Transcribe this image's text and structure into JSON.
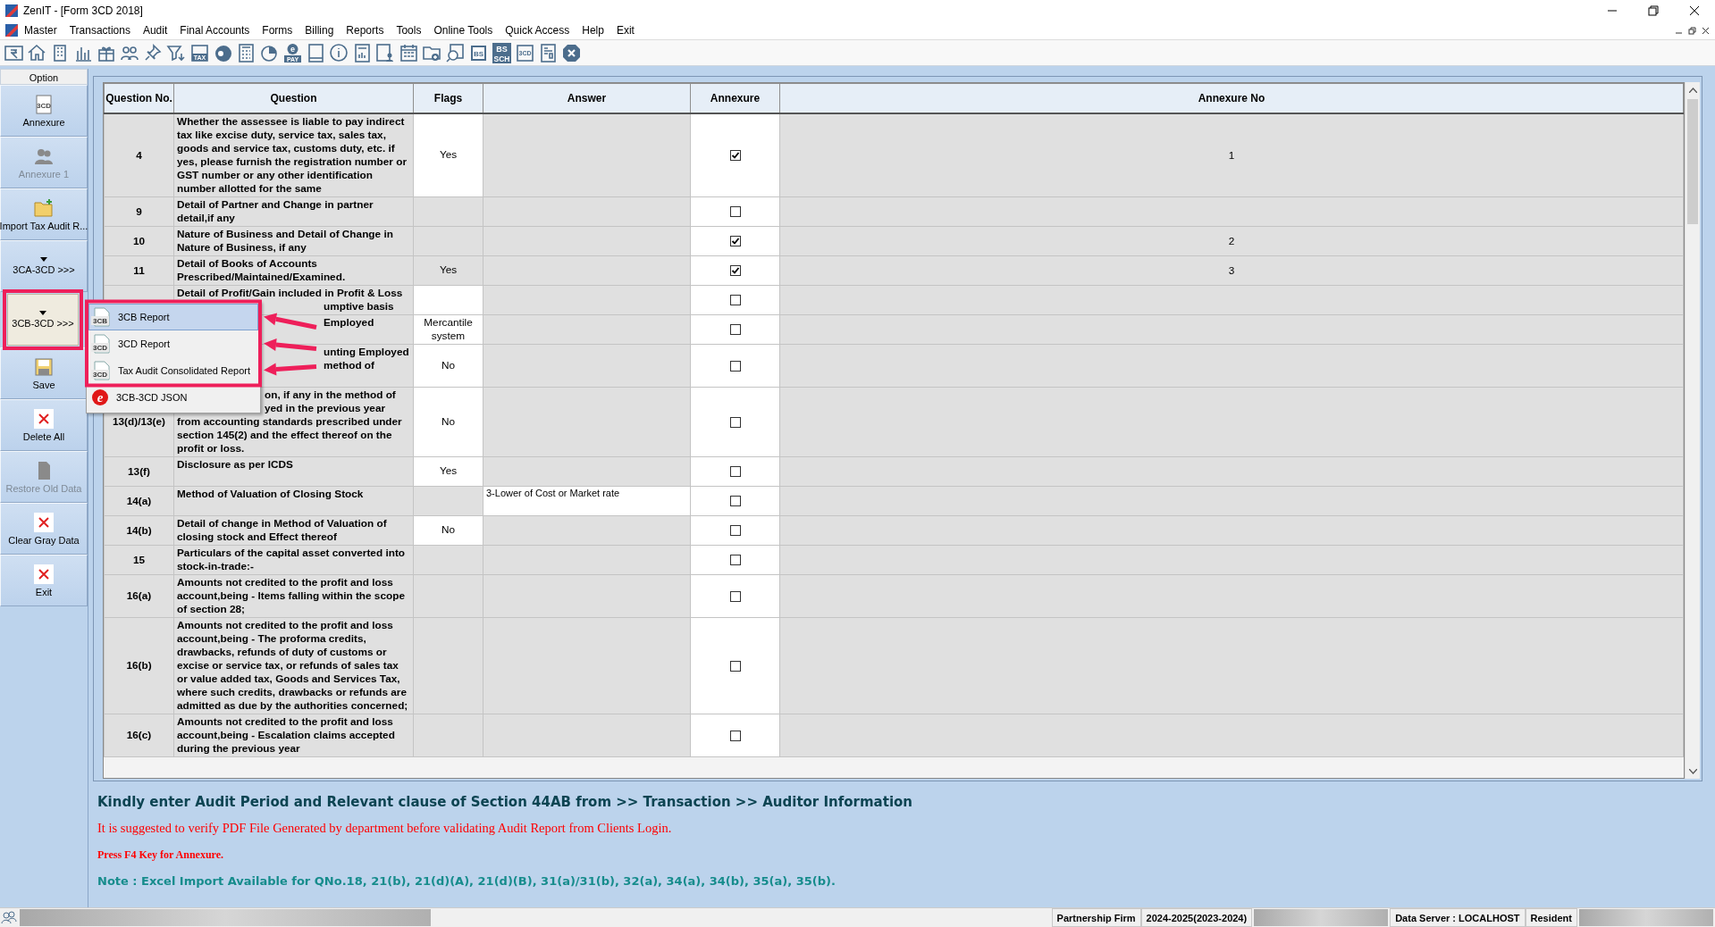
{
  "window": {
    "title": "ZenIT - [Form 3CD 2018]"
  },
  "menu": [
    "Master",
    "Transactions",
    "Audit",
    "Final Accounts",
    "Forms",
    "Billing",
    "Reports",
    "Tools",
    "Online Tools",
    "Quick Access",
    "Help",
    "Exit"
  ],
  "toolbar": [
    {
      "kind": "rupee"
    },
    {
      "kind": "home"
    },
    {
      "kind": "building"
    },
    {
      "kind": "bars"
    },
    {
      "kind": "gift"
    },
    {
      "kind": "people"
    },
    {
      "kind": "pin"
    },
    {
      "kind": "filter"
    },
    {
      "kind": "tax",
      "labels": [
        "TAX"
      ]
    },
    {
      "kind": "disc"
    },
    {
      "kind": "calc"
    },
    {
      "kind": "pie"
    },
    {
      "kind": "epay",
      "labels": [
        "e",
        "PAY"
      ]
    },
    {
      "kind": "book"
    },
    {
      "kind": "info"
    },
    {
      "kind": "report"
    },
    {
      "kind": "userdoc"
    },
    {
      "kind": "calendar"
    },
    {
      "kind": "folderplus"
    },
    {
      "kind": "searchdoc"
    },
    {
      "kind": "bs",
      "labels": [
        "BS"
      ]
    },
    {
      "kind": "bssch",
      "labels": [
        "BS",
        "SCH"
      ]
    },
    {
      "kind": "doc3cd",
      "labels": [
        "3CD"
      ]
    },
    {
      "kind": "sheet"
    },
    {
      "kind": "close"
    }
  ],
  "sidebar": {
    "title": "Option",
    "items": [
      {
        "label": "Annexure",
        "kind": "doc3cd",
        "icon_text": "3CD",
        "disabled": false,
        "pressed": false
      },
      {
        "label": "Annexure 1",
        "kind": "people",
        "disabled": true,
        "pressed": false
      },
      {
        "label": "Import Tax Audit R...",
        "kind": "folderplus",
        "disabled": false,
        "pressed": false
      },
      {
        "label": "3CA-3CD >>>",
        "kind": "dropdown",
        "disabled": false,
        "pressed": false
      },
      {
        "label": "3CB-3CD >>>",
        "kind": "dropdown",
        "disabled": false,
        "pressed": true
      },
      {
        "label": "Save",
        "kind": "save",
        "disabled": false,
        "pressed": false
      },
      {
        "label": "Delete All",
        "kind": "cross",
        "disabled": false,
        "pressed": false
      },
      {
        "label": "Restore Old Data",
        "kind": "doc",
        "disabled": true,
        "pressed": false
      },
      {
        "label": "Clear Gray Data",
        "kind": "cross",
        "disabled": false,
        "pressed": false
      },
      {
        "label": "Exit",
        "kind": "cross",
        "disabled": false,
        "pressed": false
      }
    ]
  },
  "popup_menu": {
    "items": [
      {
        "label": "3CB Report",
        "kind": "doc",
        "icon_text": "3CB",
        "selected": true
      },
      {
        "label": "3CD Report",
        "kind": "doc",
        "icon_text": "3CD",
        "selected": false
      },
      {
        "label": "Tax Audit Consolidated Report",
        "kind": "doc",
        "icon_text": "3CD",
        "selected": false
      },
      {
        "label": "3CB-3CD JSON",
        "kind": "elogo",
        "icon_text": "e",
        "selected": false
      }
    ]
  },
  "table": {
    "columns": [
      "Question No.",
      "Question",
      "Flags",
      "Answer",
      "Annexure",
      "Annexure No"
    ],
    "rows": [
      {
        "qno": "4",
        "question": [
          {
            "text": "Whether the assessee is liable to pay indirect tax like excise duty, service tax, sales tax, goods and service tax, customs duty, etc. if yes, please furnish the registration number or GST number or any other identification number allotted for the same"
          }
        ],
        "flag": "Yes",
        "flag_editable": true,
        "annexure": true,
        "annexure_no": "1"
      },
      {
        "qno": "9",
        "question": [
          {
            "text": "Detail of Partner and Change in partner detail,if any"
          }
        ],
        "flag_editable": false,
        "annexure": false
      },
      {
        "qno": "10",
        "question": [
          {
            "text": "Nature of Business and Detail of Change in Nature of Business, if any"
          }
        ],
        "flag_editable": false,
        "annexure": true,
        "annexure_no": "2"
      },
      {
        "qno": "11",
        "question": [
          {
            "text": "Detail of Books of Accounts Prescribed/Maintained/Examined."
          }
        ],
        "flag": "Yes",
        "flag_editable": false,
        "annexure": true,
        "annexure_no": "3"
      },
      {
        "question": [
          {
            "text": "Detail of Profit/Gain included in Profit & Loss"
          },
          {
            "text": "umptive basis",
            "cut": true
          }
        ],
        "flag_editable": true,
        "annexure": false
      },
      {
        "question": [
          {
            "text": "Employed",
            "cut": true
          }
        ],
        "flag": "Mercantile system",
        "flag_editable": true,
        "annexure": false
      },
      {
        "question": [
          {
            "text": "unting Employed",
            "cut": true
          },
          {
            "text": "method of",
            "cut": true
          }
        ],
        "flag": "No",
        "flag_editable": true,
        "annexure": false
      },
      {
        "qno": "13(d)/13(e)",
        "question": [
          {
            "text": "on, if any in the method of",
            "cut": true
          },
          {
            "text": "yed in the previous year",
            "cut": true
          },
          {
            "text": "from accounting standards prescribed under section 145(2) and the effect thereof on the profit or loss."
          }
        ],
        "flag": "No",
        "flag_editable": true,
        "annexure": false
      },
      {
        "qno": "13(f)",
        "question": [
          {
            "text": "Disclosure as per ICDS"
          }
        ],
        "flag": "Yes",
        "flag_editable": true,
        "annexure": false
      },
      {
        "qno": "14(a)",
        "question": [
          {
            "text": "Method of Valuation of Closing Stock"
          }
        ],
        "flag_editable": false,
        "answer": "3-Lower of Cost or Market rate",
        "answer_editable": true,
        "annexure": false
      },
      {
        "qno": "14(b)",
        "question": [
          {
            "text": "Detail of change in Method of Valuation of closing stock and Effect thereof"
          }
        ],
        "flag": "No",
        "flag_editable": true,
        "annexure": false
      },
      {
        "qno": "15",
        "question": [
          {
            "text": "Particulars of the capital asset converted into stock-in-trade:-"
          }
        ],
        "flag_editable": false,
        "annexure": false
      },
      {
        "qno": "16(a)",
        "question": [
          {
            "text": "Amounts not credited to the profit and loss account,being - Items falling within the scope of section 28;"
          }
        ],
        "flag_editable": false,
        "annexure": false
      },
      {
        "qno": "16(b)",
        "question": [
          {
            "text": "Amounts not credited to the profit and loss account,being - The proforma credits, drawbacks, refunds of duty of customs or excise or service tax, or refunds  of sales tax or value added tax, Goods and Services Tax, where such credits, drawbacks or refunds are admitted as due by the authorities concerned;"
          }
        ],
        "flag_editable": false,
        "annexure": false
      },
      {
        "qno": "16(c)",
        "question": [
          {
            "text": "Amounts not credited to the profit and loss account,being - Escalation claims accepted during the previous  year"
          }
        ],
        "flag_editable": false,
        "annexure": false
      }
    ]
  },
  "messages": [
    {
      "kind": "heading",
      "text": "Kindly enter Audit Period and Relevant clause of Section 44AB from >> Transaction >> Auditor Information"
    },
    {
      "kind": "warning",
      "text": "It is suggested to verify PDF File Generated by department before validating Audit Report from Clients Login."
    },
    {
      "kind": "hint",
      "text": "Press F4 Key for Annexure."
    },
    {
      "kind": "note",
      "text": "Note : Excel Import Available for QNo.18, 21(b), 21(d)(A), 21(d)(B), 31(a)/31(b), 32(a), 34(a), 34(b), 35(a), 35(b)."
    }
  ],
  "status_bar": [
    {
      "kind": "blurred"
    },
    {
      "kind": "spacer"
    },
    {
      "kind": "text",
      "text": "Partnership Firm"
    },
    {
      "kind": "text",
      "text": "2024-2025(2023-2024)"
    },
    {
      "kind": "blurred"
    },
    {
      "kind": "text",
      "text": "Data Server : LOCALHOST"
    },
    {
      "kind": "text",
      "text": "Resident"
    },
    {
      "kind": "blurred"
    }
  ]
}
